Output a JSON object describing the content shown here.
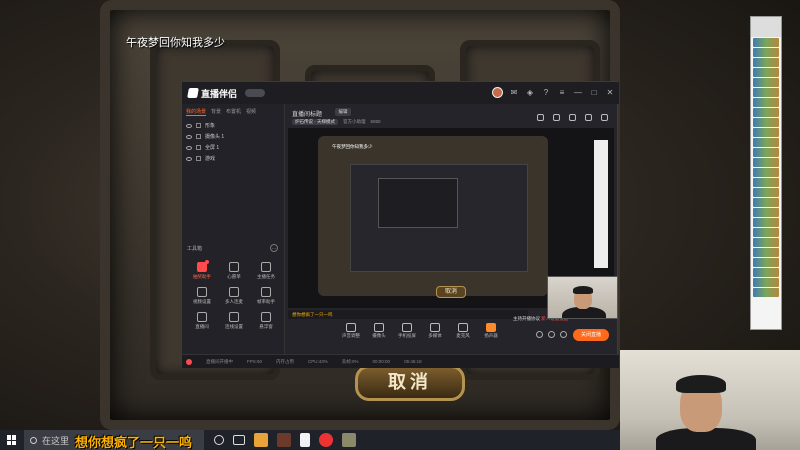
{
  "overlay_danmu": {
    "top": "午夜梦回你知我多少",
    "bottom": "想你想疯了一只一鸣"
  },
  "game": {
    "cancel_label": "取消"
  },
  "app": {
    "name": "直播伴侣",
    "version_badge": "",
    "scene_tabs": [
      "我的场景",
      "背景",
      "布置机",
      "视频"
    ],
    "sources": [
      "形象",
      "摄像头 1",
      "全屏 1",
      "游戏"
    ],
    "tools_label": "工具箱",
    "tools": [
      {
        "label": "抽奖助手",
        "hot": true
      },
      {
        "label": "心愿单",
        "hot": false
      },
      {
        "label": "主播任务",
        "hot": false
      },
      {
        "label": "视频设置",
        "hot": false
      },
      {
        "label": "多人连麦",
        "hot": false
      },
      {
        "label": "帧率助手",
        "hot": false
      },
      {
        "label": "直播间",
        "hot": false
      },
      {
        "label": "连线设置",
        "hot": false
      },
      {
        "label": "悬浮窗",
        "hot": false
      }
    ],
    "room_title": "直播间标题",
    "edit_label": "编辑",
    "room_meta_chip": "炉石传说 · 天梯模式",
    "room_meta_1": "官方小助理",
    "room_meta_2": "6060",
    "preview_danmu": "午夜梦回你知我多少",
    "preview_cancel": "取消",
    "danmu_input_prefix": "",
    "danmu_input_text": "想你想疯了一只一鸣",
    "notice_prefix": "主持开播协议",
    "notice_highlight": "新人设置提醒",
    "bottom_tools": [
      "声音调整",
      "摄像头",
      "手机投屏",
      "多媒体",
      "麦克风",
      "扬声器"
    ],
    "start_stream": "关闭直播",
    "status": [
      "直播间开播中",
      "FPS:60",
      "内存占用",
      "CPU:43%",
      "丢帧:0%",
      "00:00:00",
      "05:45:18"
    ]
  },
  "taskbar": {
    "search_placeholder": "在这里"
  },
  "colors": {
    "accent_orange": "#ff6a1a",
    "danmu_yellow": "#ffb300",
    "app_bg": "#24242a"
  }
}
